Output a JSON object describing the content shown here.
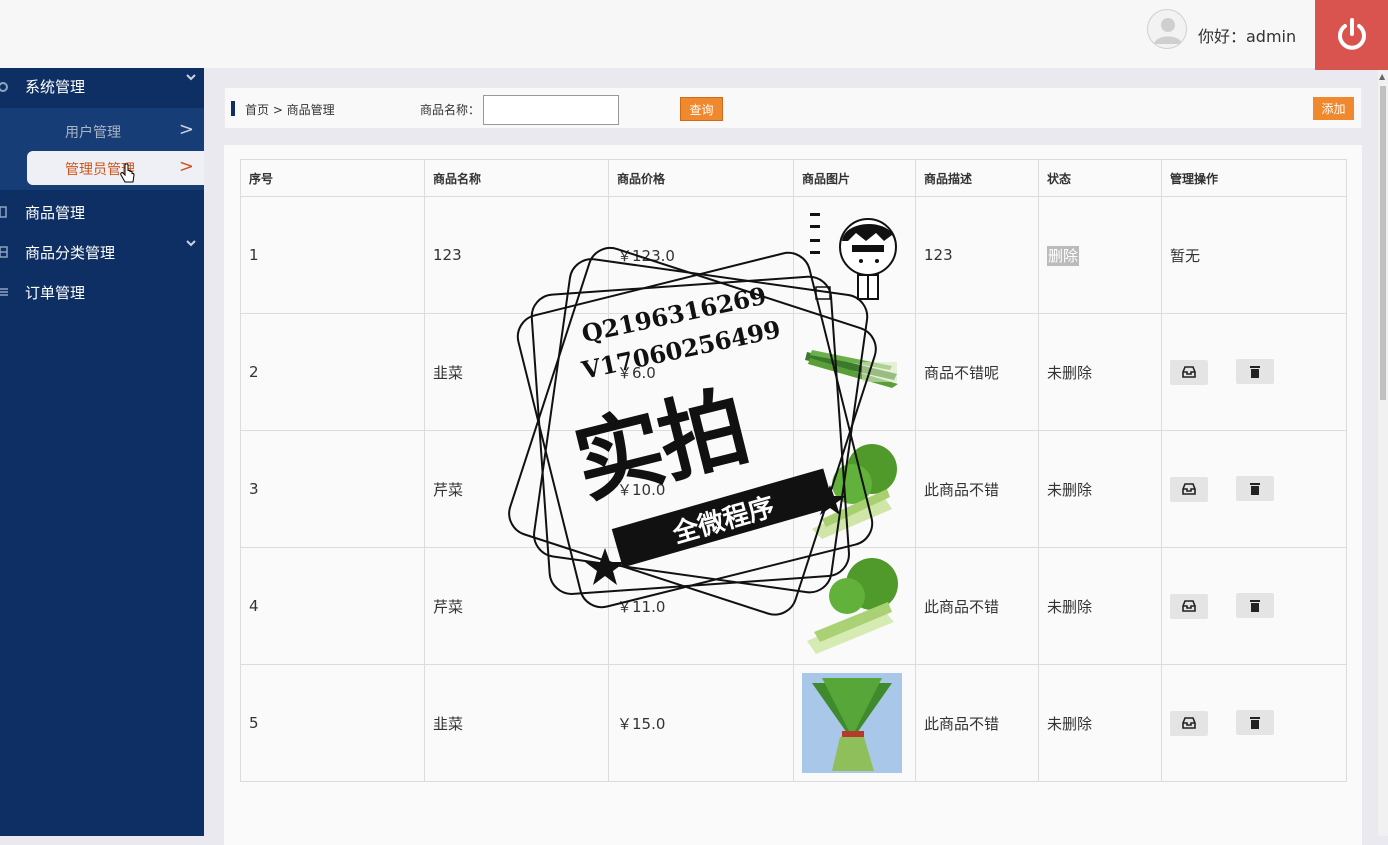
{
  "header": {
    "greeting": "你好：admin"
  },
  "sidebar": {
    "groups": [
      {
        "label": "系统管理",
        "expanded": true
      },
      {
        "label": "商品管理"
      },
      {
        "label": "商品分类管理"
      },
      {
        "label": "订单管理"
      }
    ],
    "sub_items": [
      {
        "label": "用户管理",
        "arrow": ">"
      },
      {
        "label": "管理员管理",
        "arrow": ">",
        "active": true
      }
    ]
  },
  "toolbar": {
    "breadcrumb": "首页 >  商品管理",
    "search_label": "商品名称：",
    "search_value": "",
    "query_label": "查询",
    "add_label": "添加"
  },
  "table": {
    "headers": [
      "序号",
      "商品名称",
      "商品价格",
      "商品图片",
      "商品描述",
      "状态",
      "管理操作"
    ],
    "rows": [
      {
        "id": "1",
        "name": "123",
        "price": "￥123.0",
        "desc": "123",
        "status": "删除",
        "op": "暂无"
      },
      {
        "id": "2",
        "name": "韭菜",
        "price": "￥6.0",
        "desc": "商品不错呢",
        "status": "未删除",
        "op": ""
      },
      {
        "id": "3",
        "name": "芹菜",
        "price": "￥10.0",
        "desc": "此商品不错",
        "status": "未删除",
        "op": ""
      },
      {
        "id": "4",
        "name": "芹菜",
        "price": "￥11.0",
        "desc": "此商品不错",
        "status": "未删除",
        "op": ""
      },
      {
        "id": "5",
        "name": "韭菜",
        "price": "￥15.0",
        "desc": "此商品不错",
        "status": "未删除",
        "op": ""
      }
    ]
  },
  "watermark": {
    "line1": "Q2196316269",
    "line2": "V17060256499",
    "big": "实拍",
    "ribbon": "全微程序"
  },
  "colors": {
    "sidebar": "#0e2f63",
    "accent": "#f0892d",
    "logout": "#d9534f"
  }
}
